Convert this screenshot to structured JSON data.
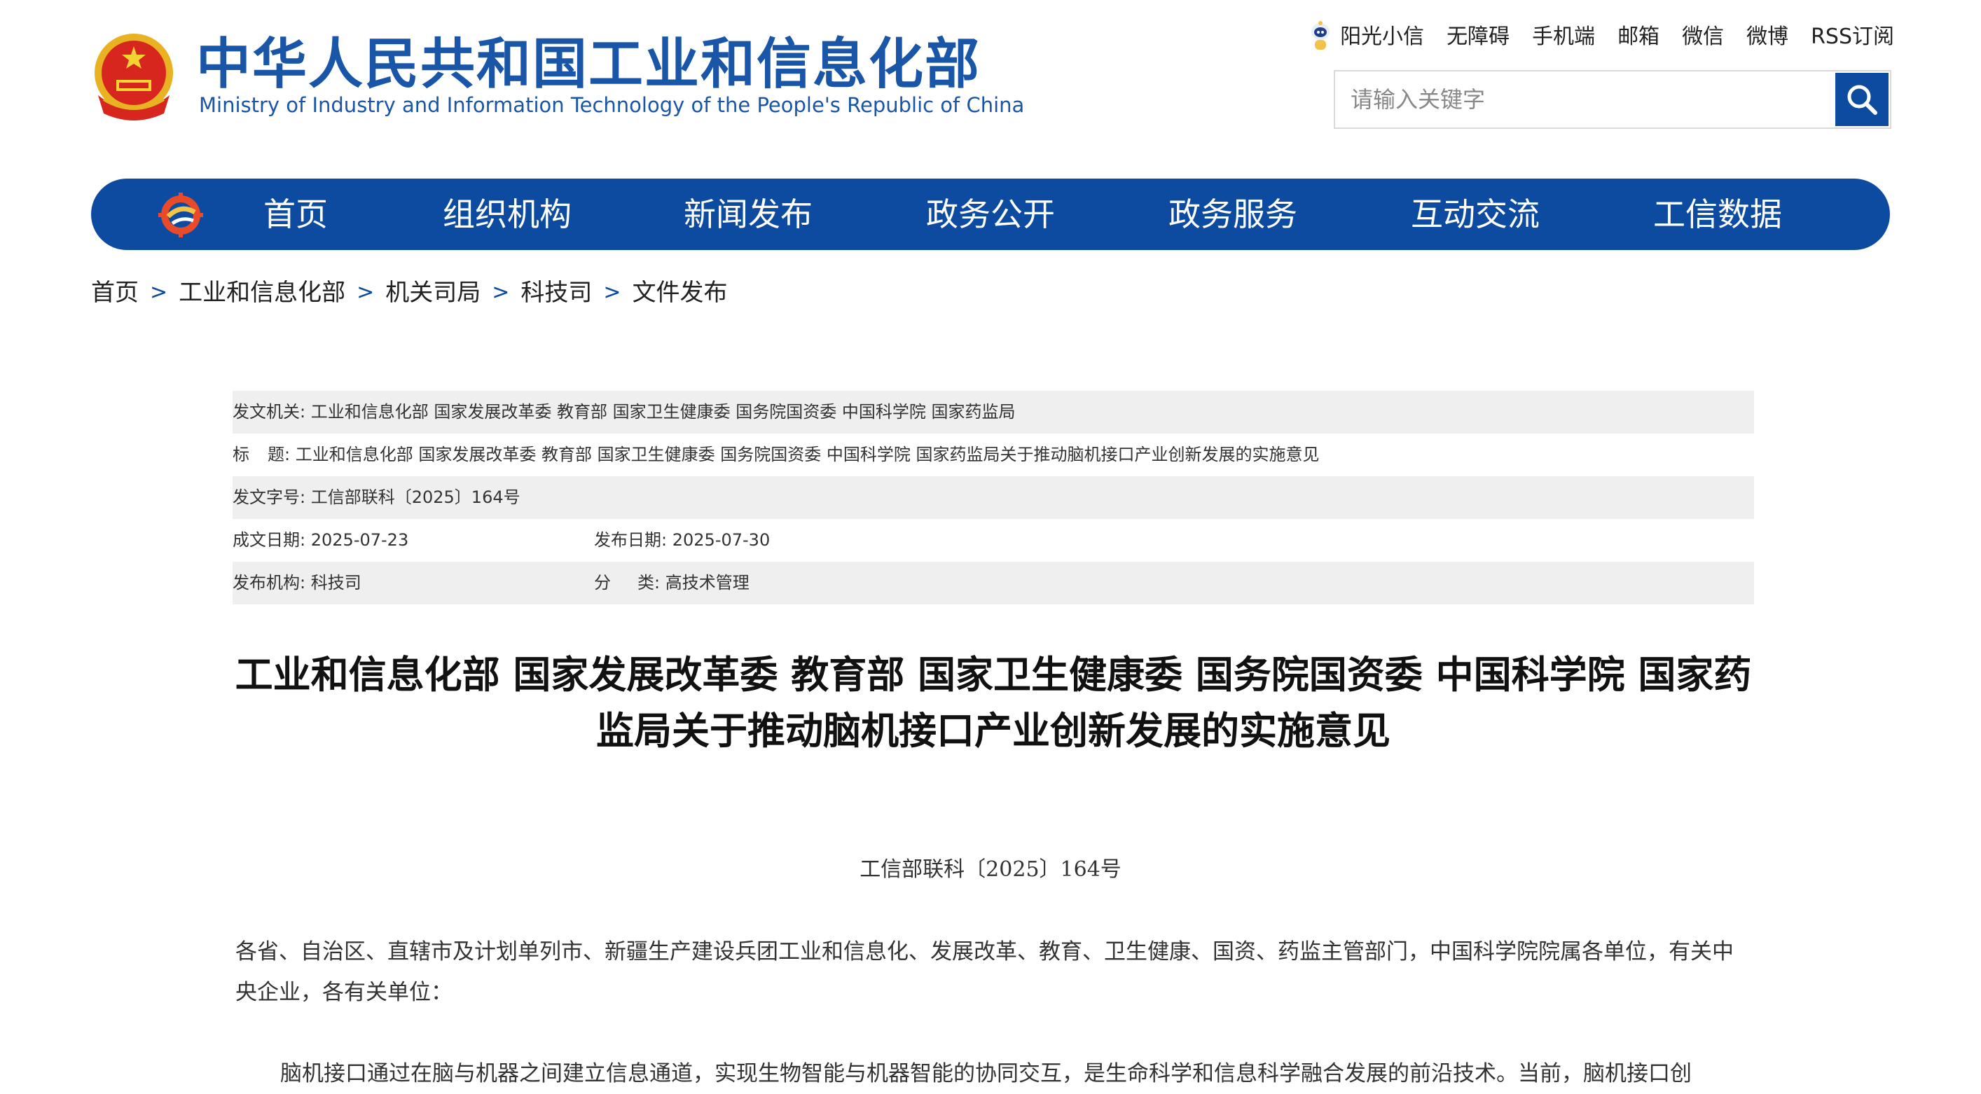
{
  "header": {
    "title_cn": "中华人民共和国工业和信息化部",
    "title_en": "Ministry of Industry and Information Technology of the People's Republic of China",
    "links": [
      "阳光小信",
      "无障碍",
      "手机端",
      "邮箱",
      "微信",
      "微博",
      "RSS订阅"
    ],
    "search_placeholder": "请输入关键字"
  },
  "nav": {
    "items": [
      "首页",
      "组织机构",
      "新闻发布",
      "政务公开",
      "政务服务",
      "互动交流",
      "工信数据"
    ]
  },
  "breadcrumb": [
    "首页",
    "工业和信息化部",
    "机关司局",
    "科技司",
    "文件发布"
  ],
  "meta": {
    "issuer_label": "发文机关:",
    "issuer": "工业和信息化部 国家发展改革委 教育部 国家卫生健康委 国务院国资委 中国科学院 国家药监局",
    "subject_label_a": "标",
    "subject_label_b": "题:",
    "subject": "工业和信息化部 国家发展改革委 教育部 国家卫生健康委 国务院国资委 中国科学院 国家药监局关于推动脑机接口产业创新发展的实施意见",
    "doc_no_label": "发文字号:",
    "doc_no": "工信部联科〔2025〕164号",
    "written_label": "成文日期:",
    "written_date": "2025-07-23",
    "published_label": "发布日期:",
    "published_date": "2025-07-30",
    "org_label": "发布机构:",
    "org": "科技司",
    "category_label_a": "分",
    "category_label_b": "类:",
    "category": "高技术管理"
  },
  "article": {
    "title": "工业和信息化部 国家发展改革委 教育部 国家卫生健康委 国务院国资委 中国科学院 国家药监局关于推动脑机接口产业创新发展的实施意见",
    "doc_number": "工信部联科〔2025〕164号",
    "salutation": "各省、自治区、直辖市及计划单列市、新疆生产建设兵团工业和信息化、发展改革、教育、卫生健康、国资、药监主管部门，中国科学院院属各单位，有关中央企业，各有关单位：",
    "para1": "脑机接口通过在脑与机器之间建立信息通道，实现生物智能与机器智能的协同交互，是生命科学和信息科学融合发展的前沿技术。当前，脑机接口创"
  },
  "colors": {
    "brand_blue": "#0d4ba0",
    "title_blue": "#1a56a8",
    "row_grey": "#efefef"
  }
}
